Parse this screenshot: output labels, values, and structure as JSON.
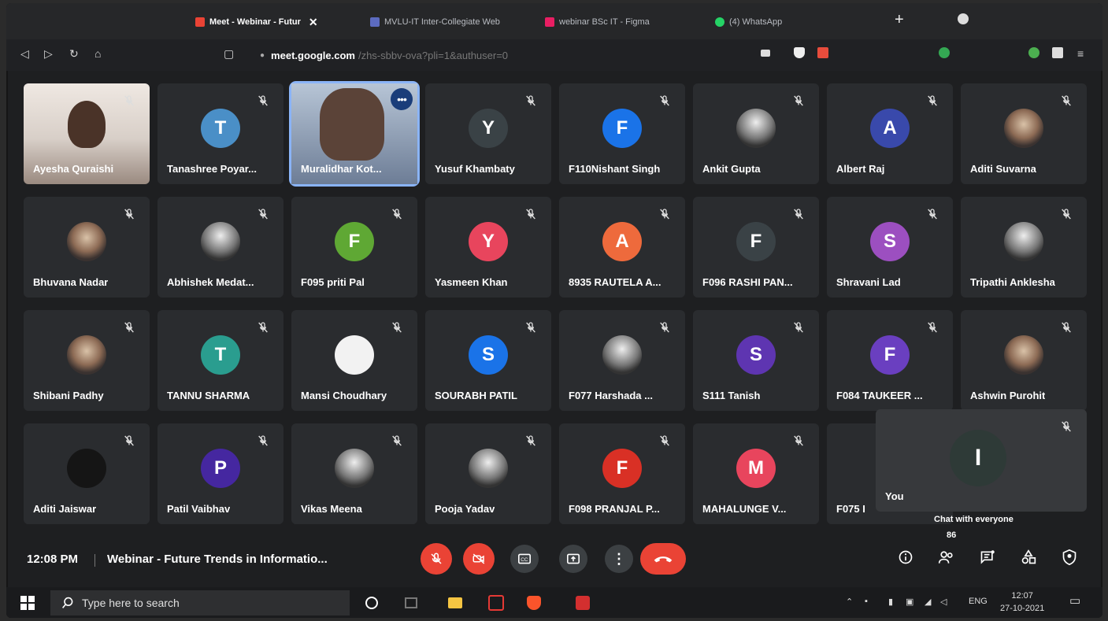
{
  "browser": {
    "tabs": [
      {
        "label": "Meet - Webinar - Futur",
        "active": true,
        "color": "#ea4335"
      },
      {
        "label": "MVLU-IT Inter-Collegiate Web",
        "active": false,
        "color": "#5c6bc0"
      },
      {
        "label": "webinar BSc IT - Figma",
        "active": false,
        "color": "#e91e63"
      },
      {
        "label": "(4) WhatsApp",
        "active": false,
        "color": "#25d366"
      }
    ],
    "url_host": "meet.google.com",
    "url_path": "/zhs-sbbv-ova?pli=1&authuser=0"
  },
  "participants": [
    {
      "name": "Ayesha Quraishi",
      "initial": "",
      "color": "",
      "kind": "video-ayesha"
    },
    {
      "name": "Tanashree Poyar...",
      "initial": "T",
      "color": "#4a8fc7",
      "kind": "letter"
    },
    {
      "name": "Muralidhar Kot...",
      "initial": "",
      "color": "",
      "kind": "video-mural"
    },
    {
      "name": "Yusuf Khambaty",
      "initial": "Y",
      "color": "#3a4246",
      "kind": "letter"
    },
    {
      "name": "F110Nishant Singh",
      "initial": "F",
      "color": "#1a73e8",
      "kind": "letter"
    },
    {
      "name": "Ankit Gupta",
      "initial": "",
      "color": "",
      "kind": "photo2"
    },
    {
      "name": "Albert Raj",
      "initial": "A",
      "color": "#3949ab",
      "kind": "letter"
    },
    {
      "name": "Aditi Suvarna",
      "initial": "",
      "color": "",
      "kind": "photo"
    },
    {
      "name": "Bhuvana Nadar",
      "initial": "",
      "color": "",
      "kind": "photo"
    },
    {
      "name": "Abhishek Medat...",
      "initial": "",
      "color": "",
      "kind": "photo2"
    },
    {
      "name": "F095 priti Pal",
      "initial": "F",
      "color": "#5fa834",
      "kind": "letter"
    },
    {
      "name": "Yasmeen Khan",
      "initial": "Y",
      "color": "#e8455d",
      "kind": "letter"
    },
    {
      "name": "8935 RAUTELA A...",
      "initial": "A",
      "color": "#ee6a3c",
      "kind": "letter"
    },
    {
      "name": "F096 RASHI PAN...",
      "initial": "F",
      "color": "#3a4246",
      "kind": "letter"
    },
    {
      "name": "Shravani Lad",
      "initial": "S",
      "color": "#9c4fc0",
      "kind": "letter"
    },
    {
      "name": "Tripathi Anklesha",
      "initial": "",
      "color": "",
      "kind": "photo2"
    },
    {
      "name": "Shibani Padhy",
      "initial": "",
      "color": "",
      "kind": "photo"
    },
    {
      "name": "TANNU SHARMA",
      "initial": "T",
      "color": "#2a9d8f",
      "kind": "letter"
    },
    {
      "name": "Mansi Choudhary",
      "initial": "",
      "color": "",
      "kind": "white"
    },
    {
      "name": "SOURABH PATIL",
      "initial": "S",
      "color": "#1a73e8",
      "kind": "letter"
    },
    {
      "name": "F077 Harshada ...",
      "initial": "",
      "color": "",
      "kind": "photo2"
    },
    {
      "name": "S111 Tanish",
      "initial": "S",
      "color": "#5e35b1",
      "kind": "letter"
    },
    {
      "name": "F084 TAUKEER ...",
      "initial": "F",
      "color": "#6a3fc0",
      "kind": "letter"
    },
    {
      "name": "Ashwin Purohit",
      "initial": "",
      "color": "",
      "kind": "photo"
    },
    {
      "name": "Aditi Jaiswar",
      "initial": "",
      "color": "",
      "kind": "dark"
    },
    {
      "name": "Patil Vaibhav",
      "initial": "P",
      "color": "#4527a0",
      "kind": "letter"
    },
    {
      "name": "Vikas Meena",
      "initial": "",
      "color": "",
      "kind": "photo2"
    },
    {
      "name": "Pooja Yadav",
      "initial": "",
      "color": "",
      "kind": "photo2"
    },
    {
      "name": "F098 PRANJAL P...",
      "initial": "F",
      "color": "#d93025",
      "kind": "letter"
    },
    {
      "name": "MAHALUNGE V...",
      "initial": "M",
      "color": "#e8455d",
      "kind": "letter"
    },
    {
      "name": "F075 I",
      "initial": "",
      "color": "",
      "kind": "none"
    },
    {
      "name": "You",
      "initial": "I",
      "color": "#2e3a37",
      "kind": "self"
    }
  ],
  "meeting": {
    "time": "12:08 PM",
    "title": "Webinar - Future Trends in Informatio...",
    "chat_label": "Chat with everyone",
    "participant_count": "86"
  },
  "taskbar": {
    "search_placeholder": "Type here to search",
    "lang": "ENG",
    "time": "12:07",
    "date": "27-10-2021"
  }
}
